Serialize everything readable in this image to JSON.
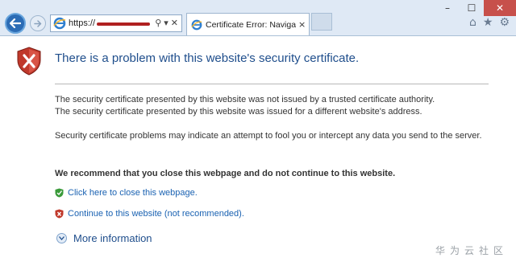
{
  "browser": {
    "address_url": "https://",
    "tab_title": "Certificate Error: Navigation...",
    "tab_close": "×",
    "address_tools": {
      "search": "⚲",
      "dropdown": "▾",
      "refresh": "✕"
    },
    "window_controls": {
      "minimize": "–",
      "maximize": "☐",
      "close": "✕"
    },
    "toolbar_icons": {
      "home": "⌂",
      "favorites": "★",
      "tools": "⚙"
    }
  },
  "content": {
    "headline": "There is a problem with this website's security certificate.",
    "paragraph1_line1": "The security certificate presented by this website was not issued by a trusted certificate authority.",
    "paragraph1_line2": "The security certificate presented by this website was issued for a different website's address.",
    "paragraph2": "Security certificate problems may indicate an attempt to fool you or intercept any data you send to the server.",
    "recommendation": "We recommend that you close this webpage and do not continue to this website.",
    "close_link": "Click here to close this webpage.",
    "continue_link": "Continue to this website (not recommended).",
    "more_info": "More information"
  },
  "watermark": "华为云社区",
  "colors": {
    "headline": "#1f4e8c",
    "link": "#1a62b2",
    "shield_red": "#c0392b",
    "shield_green": "#3a9a3a",
    "close_button": "#c7504b"
  }
}
